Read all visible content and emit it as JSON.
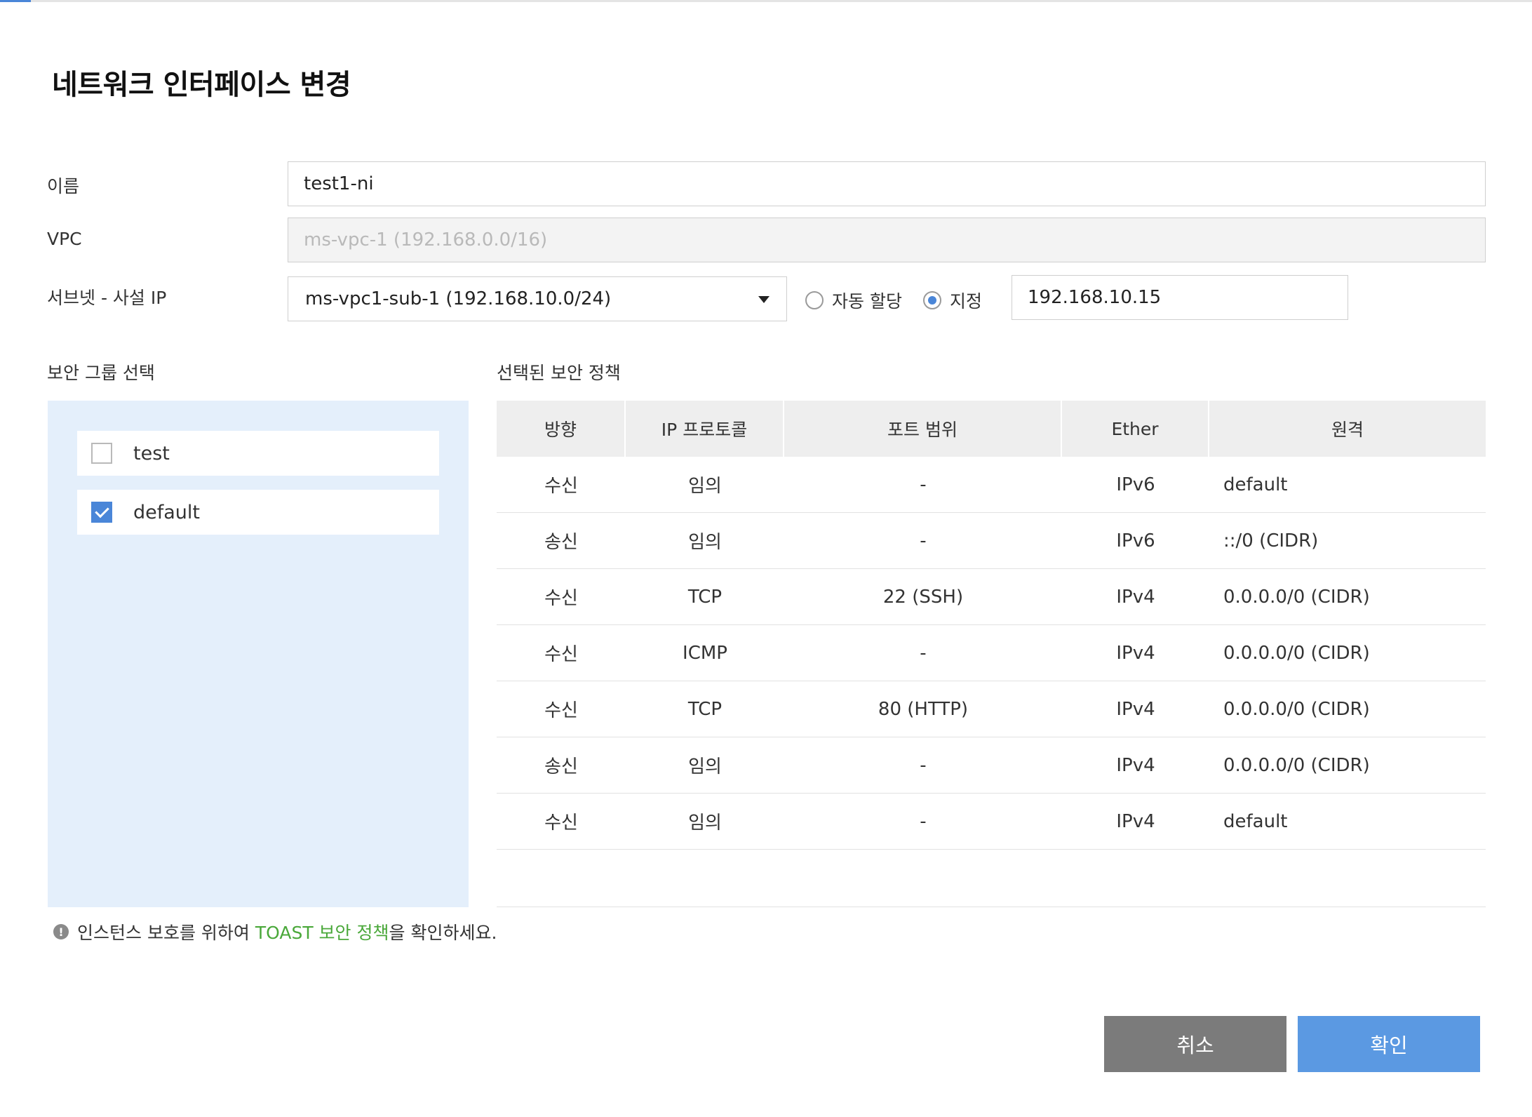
{
  "dialog": {
    "title": "네트워크 인터페이스 변경"
  },
  "form": {
    "name_label": "이름",
    "name_value": "test1-ni",
    "vpc_label": "VPC",
    "vpc_value": "ms-vpc-1 (192.168.0.0/16)",
    "subnet_label": "서브넷 - 사설 IP",
    "subnet_value": "ms-vpc1-sub-1 (192.168.10.0/24)",
    "ip_mode_auto": "자동 할당",
    "ip_mode_manual": "지정",
    "ip_mode_selected": "지정",
    "ip_value": "192.168.10.15"
  },
  "security_groups": {
    "label": "보안 그룹 선택",
    "items": [
      {
        "label": "test",
        "checked": false
      },
      {
        "label": "default",
        "checked": true
      }
    ]
  },
  "policies": {
    "label": "선택된 보안 정책",
    "columns": [
      "방향",
      "IP 프로토콜",
      "포트 범위",
      "Ether",
      "원격"
    ],
    "rows": [
      [
        "수신",
        "임의",
        "-",
        "IPv6",
        "default"
      ],
      [
        "송신",
        "임의",
        "-",
        "IPv6",
        "::/0 (CIDR)"
      ],
      [
        "수신",
        "TCP",
        "22 (SSH)",
        "IPv4",
        "0.0.0.0/0 (CIDR)"
      ],
      [
        "수신",
        "ICMP",
        "-",
        "IPv4",
        "0.0.0.0/0 (CIDR)"
      ],
      [
        "수신",
        "TCP",
        "80 (HTTP)",
        "IPv4",
        "0.0.0.0/0 (CIDR)"
      ],
      [
        "송신",
        "임의",
        "-",
        "IPv4",
        "0.0.0.0/0 (CIDR)"
      ],
      [
        "수신",
        "임의",
        "-",
        "IPv4",
        "default"
      ]
    ]
  },
  "notice": {
    "icon": "!",
    "prefix": "인스턴스 보호를 위하여 ",
    "link": "TOAST 보안 정책",
    "suffix": "을 확인하세요."
  },
  "buttons": {
    "cancel": "취소",
    "confirm": "확인"
  },
  "colors": {
    "accent": "#4a86d8",
    "link": "#4aa83a",
    "panel": "#e4effb",
    "cancel_bg": "#7b7b7b",
    "confirm_bg": "#5b99e2"
  }
}
